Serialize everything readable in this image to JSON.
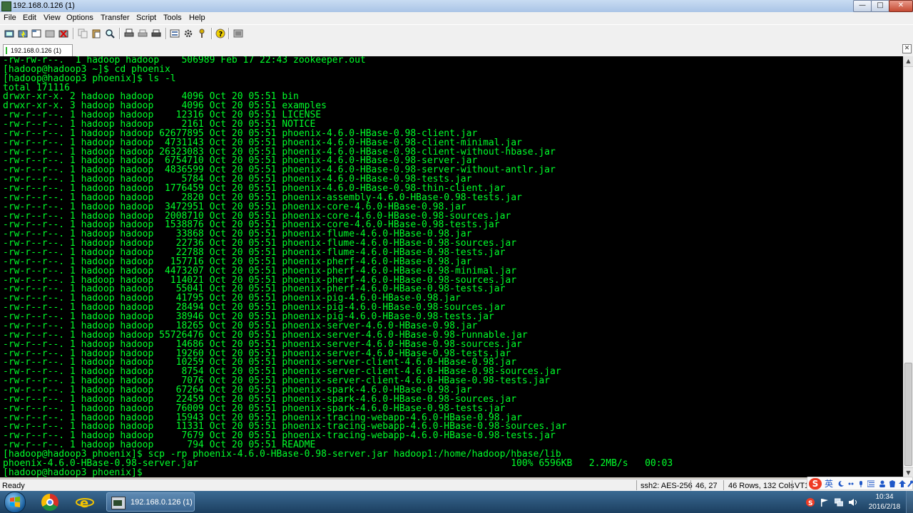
{
  "window": {
    "title": "192.168.0.126 (1)"
  },
  "menu": [
    "File",
    "Edit",
    "View",
    "Options",
    "Transfer",
    "Script",
    "Tools",
    "Help"
  ],
  "tab": {
    "label": "192.168.0.126 (1)"
  },
  "terminal": {
    "lines": [
      "-rw-rw-r--.  1 hadoop hadoop    506989 Feb 17 22:43 zookeeper.out",
      "[hadoop@hadoop3 ~]$ cd phoenix",
      "[hadoop@hadoop3 phoenix]$ ls -l",
      "total 171116",
      "drwxr-xr-x. 2 hadoop hadoop     4096 Oct 20 05:51 bin",
      "drwxr-xr-x. 3 hadoop hadoop     4096 Oct 20 05:51 examples",
      "-rw-r--r--. 1 hadoop hadoop    12316 Oct 20 05:51 LICENSE",
      "-rw-r--r--. 1 hadoop hadoop     2161 Oct 20 05:51 NOTICE",
      "-rw-r--r--. 1 hadoop hadoop 62677895 Oct 20 05:51 phoenix-4.6.0-HBase-0.98-client.jar",
      "-rw-r--r--. 1 hadoop hadoop  4731143 Oct 20 05:51 phoenix-4.6.0-HBase-0.98-client-minimal.jar",
      "-rw-r--r--. 1 hadoop hadoop 26323083 Oct 20 05:51 phoenix-4.6.0-HBase-0.98-client-without-hbase.jar",
      "-rw-r--r--. 1 hadoop hadoop  6754710 Oct 20 05:51 phoenix-4.6.0-HBase-0.98-server.jar",
      "-rw-r--r--. 1 hadoop hadoop  4836599 Oct 20 05:51 phoenix-4.6.0-HBase-0.98-server-without-antlr.jar",
      "-rw-r--r--. 1 hadoop hadoop     5784 Oct 20 05:51 phoenix-4.6.0-HBase-0.98-tests.jar",
      "-rw-r--r--. 1 hadoop hadoop  1776459 Oct 20 05:51 phoenix-4.6.0-HBase-0.98-thin-client.jar",
      "-rw-r--r--. 1 hadoop hadoop     2820 Oct 20 05:51 phoenix-assembly-4.6.0-HBase-0.98-tests.jar",
      "-rw-r--r--. 1 hadoop hadoop  3472951 Oct 20 05:51 phoenix-core-4.6.0-HBase-0.98.jar",
      "-rw-r--r--. 1 hadoop hadoop  2008710 Oct 20 05:51 phoenix-core-4.6.0-HBase-0.98-sources.jar",
      "-rw-r--r--. 1 hadoop hadoop  1538876 Oct 20 05:51 phoenix-core-4.6.0-HBase-0.98-tests.jar",
      "-rw-r--r--. 1 hadoop hadoop    33868 Oct 20 05:51 phoenix-flume-4.6.0-HBase-0.98.jar",
      "-rw-r--r--. 1 hadoop hadoop    22736 Oct 20 05:51 phoenix-flume-4.6.0-HBase-0.98-sources.jar",
      "-rw-r--r--. 1 hadoop hadoop    22788 Oct 20 05:51 phoenix-flume-4.6.0-HBase-0.98-tests.jar",
      "-rw-r--r--. 1 hadoop hadoop   157716 Oct 20 05:51 phoenix-pherf-4.6.0-HBase-0.98.jar",
      "-rw-r--r--. 1 hadoop hadoop  4473207 Oct 20 05:51 phoenix-pherf-4.6.0-HBase-0.98-minimal.jar",
      "-rw-r--r--. 1 hadoop hadoop   114021 Oct 20 05:51 phoenix-pherf-4.6.0-HBase-0.98-sources.jar",
      "-rw-r--r--. 1 hadoop hadoop    55041 Oct 20 05:51 phoenix-pherf-4.6.0-HBase-0.98-tests.jar",
      "-rw-r--r--. 1 hadoop hadoop    41795 Oct 20 05:51 phoenix-pig-4.6.0-HBase-0.98.jar",
      "-rw-r--r--. 1 hadoop hadoop    28494 Oct 20 05:51 phoenix-pig-4.6.0-HBase-0.98-sources.jar",
      "-rw-r--r--. 1 hadoop hadoop    38946 Oct 20 05:51 phoenix-pig-4.6.0-HBase-0.98-tests.jar",
      "-rw-r--r--. 1 hadoop hadoop    18265 Oct 20 05:51 phoenix-server-4.6.0-HBase-0.98.jar",
      "-rw-r--r--. 1 hadoop hadoop 55726476 Oct 20 05:51 phoenix-server-4.6.0-HBase-0.98-runnable.jar",
      "-rw-r--r--. 1 hadoop hadoop    14686 Oct 20 05:51 phoenix-server-4.6.0-HBase-0.98-sources.jar",
      "-rw-r--r--. 1 hadoop hadoop    19260 Oct 20 05:51 phoenix-server-4.6.0-HBase-0.98-tests.jar",
      "-rw-r--r--. 1 hadoop hadoop    10259 Oct 20 05:51 phoenix-server-client-4.6.0-HBase-0.98.jar",
      "-rw-r--r--. 1 hadoop hadoop     8754 Oct 20 05:51 phoenix-server-client-4.6.0-HBase-0.98-sources.jar",
      "-rw-r--r--. 1 hadoop hadoop     7076 Oct 20 05:51 phoenix-server-client-4.6.0-HBase-0.98-tests.jar",
      "-rw-r--r--. 1 hadoop hadoop    67264 Oct 20 05:51 phoenix-spark-4.6.0-HBase-0.98.jar",
      "-rw-r--r--. 1 hadoop hadoop    22459 Oct 20 05:51 phoenix-spark-4.6.0-HBase-0.98-sources.jar",
      "-rw-r--r--. 1 hadoop hadoop    76009 Oct 20 05:51 phoenix-spark-4.6.0-HBase-0.98-tests.jar",
      "-rw-r--r--. 1 hadoop hadoop    15943 Oct 20 05:51 phoenix-tracing-webapp-4.6.0-HBase-0.98.jar",
      "-rw-r--r--. 1 hadoop hadoop    11331 Oct 20 05:51 phoenix-tracing-webapp-4.6.0-HBase-0.98-sources.jar",
      "-rw-r--r--. 1 hadoop hadoop     7679 Oct 20 05:51 phoenix-tracing-webapp-4.6.0-HBase-0.98-tests.jar",
      "-rw-r--r--. 1 hadoop hadoop      794 Oct 20 05:51 README",
      "[hadoop@hadoop3 phoenix]$ scp -rp phoenix-4.6.0-HBase-0.98-server.jar hadoop1:/home/hadoop/hbase/lib",
      "phoenix-4.6.0-HBase-0.98-server.jar                                                        100% 6596KB   2.2MB/s   00:03",
      "[hadoop@hadoop3 phoenix]$ "
    ]
  },
  "status": {
    "ready": "Ready",
    "cipher": "ssh2: AES-256",
    "cursor": "46,  27",
    "size": "46 Rows, 132 Cols",
    "term": "VT1"
  },
  "ime": {
    "lang": "英"
  },
  "taskbar": {
    "task_label": "192.168.0.126 (1)",
    "time": "10:34",
    "date": "2016/2/18"
  },
  "colors": {
    "terminal_fg": "#00ff2a",
    "terminal_bg": "#000000"
  },
  "icons": {
    "toolbar": [
      "connect-icon",
      "quick-connect-icon",
      "connect-tab-icon",
      "reconnect-icon",
      "disconnect-icon",
      "copy-icon",
      "paste-icon",
      "find-icon",
      "print-icon",
      "print-setup-icon",
      "print-screen-icon",
      "session-options-icon",
      "global-options-icon",
      "keymap-icon",
      "help-icon",
      "sftp-icon"
    ]
  }
}
